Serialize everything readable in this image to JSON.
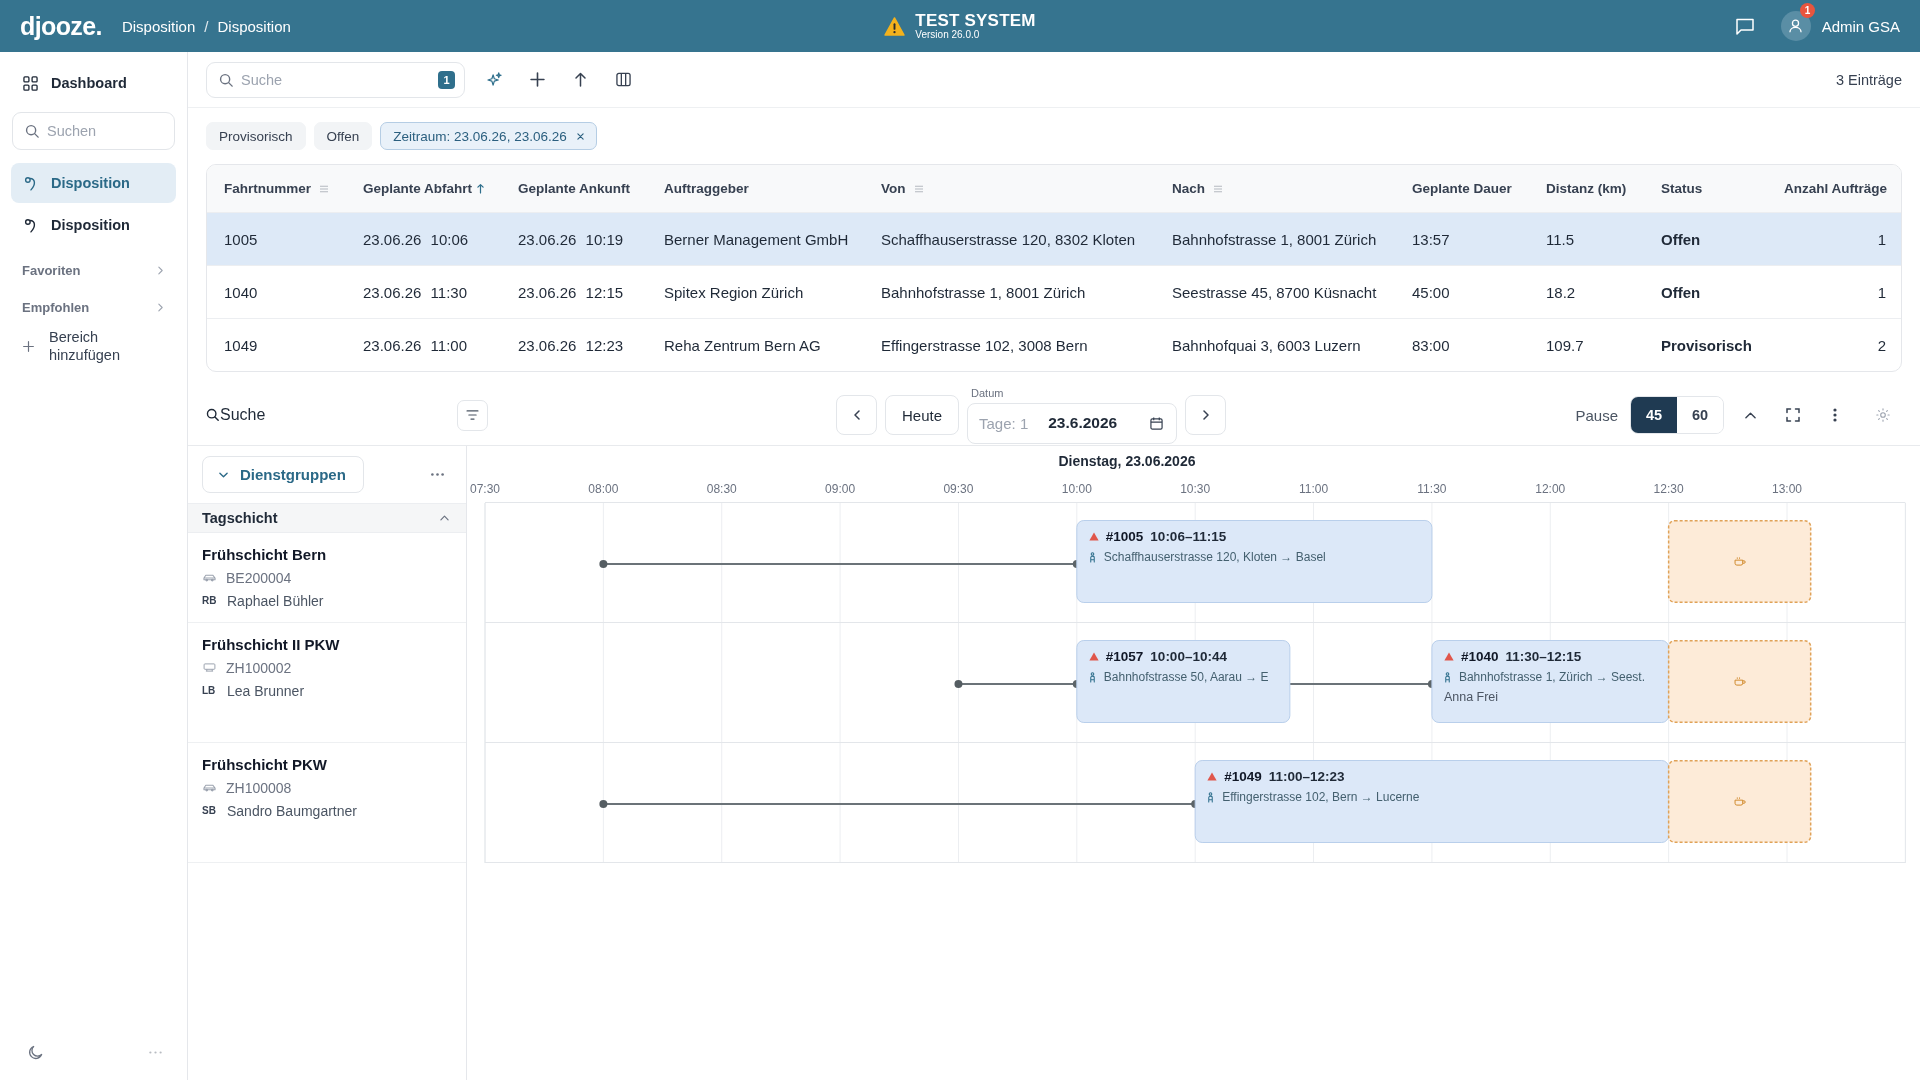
{
  "header": {
    "logo": "djooze.",
    "breadcrumb": [
      "Disposition",
      "Disposition"
    ],
    "separator": "/",
    "system_title": "TEST SYSTEM",
    "system_version": "Version 26.0.0",
    "notification_count": "1",
    "user_name": "Admin GSA"
  },
  "sidebar": {
    "items": [
      {
        "kind": "dashboard",
        "label": "Dashboard",
        "selected": false
      },
      {
        "kind": "search",
        "placeholder": "Suchen"
      },
      {
        "kind": "page",
        "label": "Disposition",
        "selected": true
      },
      {
        "kind": "page",
        "label": "Disposition",
        "selected": false
      },
      {
        "kind": "section",
        "label": "Favoriten"
      },
      {
        "kind": "section",
        "label": "Empfohlen"
      },
      {
        "kind": "add",
        "label": "Bereich hinzufügen"
      }
    ]
  },
  "toolbar": {
    "search": {
      "placeholder": "Suche",
      "badge": "1"
    },
    "count": "3 Einträge"
  },
  "filters": [
    {
      "label": "Provisorisch",
      "selected": false
    },
    {
      "label": "Offen",
      "selected": false
    },
    {
      "label": "Zeitraum: 23.06.26, 23.06.26",
      "selected": true,
      "removable": true
    }
  ],
  "table": {
    "columns": [
      {
        "label": "Fahrtnummer",
        "kind": "text",
        "filterable": true
      },
      {
        "label": "Geplante Abfahrt",
        "kind": "datetime",
        "sorted_ascending": true
      },
      {
        "label": "Geplante Ankunft",
        "kind": "datetime"
      },
      {
        "label": "Auftraggeber",
        "kind": "text"
      },
      {
        "label": "Von",
        "kind": "text",
        "filterable": true
      },
      {
        "label": "Nach",
        "kind": "text",
        "filterable": true
      },
      {
        "label": "Geplante Dauer",
        "kind": "text"
      },
      {
        "label": "Distanz (km)",
        "kind": "text"
      },
      {
        "label": "Status",
        "kind": "status"
      },
      {
        "label": "Anzahl Aufträge",
        "kind": "count"
      }
    ],
    "rows": [
      {
        "selected": true,
        "cells": [
          "1005",
          "23.06.26 10:06",
          "23.06.26 10:19",
          "Berner Management GmbH",
          "Schaffhauserstrasse 120, 8302 Kloten",
          "Bahnhofstrasse 1, 8001 Zürich",
          "13:57",
          "11.5",
          "Offen",
          "1"
        ]
      },
      {
        "selected": false,
        "cells": [
          "1040",
          "23.06.26 11:30",
          "23.06.26 12:15",
          "Spitex Region Zürich",
          "Bahnhofstrasse 1, 8001 Zürich",
          "Seestrasse 45, 8700 Küsnacht",
          "45:00",
          "18.2",
          "Offen",
          "1"
        ]
      },
      {
        "selected": false,
        "cells": [
          "1049",
          "23.06.26 11:00",
          "23.06.26 12:23",
          "Reha Zentrum Bern AG",
          "Effingerstrasse 102, 3008 Bern",
          "Bahnhofquai 3, 6003 Luzern",
          "83:00",
          "109.7",
          "Provisorisch",
          "2"
        ]
      }
    ]
  },
  "planner": {
    "search": {
      "placeholder": "Suche"
    },
    "today_button": "Heute",
    "date": {
      "label": "Datum",
      "days": "Tage: 1",
      "value": "23.6.2026"
    },
    "pause": {
      "label": "Pause",
      "options": [
        {
          "label": "45",
          "selected": true
        },
        {
          "label": "60",
          "selected": false
        }
      ]
    },
    "groups_button": "Dienstgruppen",
    "groups": [
      {
        "name": "Tagschicht",
        "expanded": true,
        "shifts": [
          {
            "name": "Frühschicht Bern",
            "vehicle": {
              "kind": "car",
              "plate": "BE200004"
            },
            "driver": {
              "initials": "RB",
              "name": "Raphael Bühler"
            },
            "trips": [
              {
                "number": "#1005",
                "time": "10:06–11:15",
                "route": "Schaffhauserstrasse 120, Kloten → Basel",
                "warning": true
              }
            ]
          },
          {
            "name": "Frühschicht II PKW",
            "vehicle": {
              "kind": "van",
              "plate": "ZH100002"
            },
            "driver": {
              "initials": "LB",
              "name": "Lea Brunner"
            },
            "trips": [
              {
                "number": "#1057",
                "time": "10:00–10:44",
                "route": "Bahnhofstrasse 50, Aarau → E",
                "warning": true
              },
              {
                "number": "#1040",
                "time": "11:30–12:15",
                "route": "Bahnhofstrasse 1, Zürich → Seest.",
                "person_name": "Anna Frei",
                "warning": true
              }
            ]
          },
          {
            "name": "Frühschicht PKW",
            "vehicle": {
              "kind": "car",
              "plate": "ZH100008"
            },
            "driver": {
              "initials": "SB",
              "name": "Sandro Baumgartner"
            },
            "trips": [
              {
                "number": "#1049",
                "time": "11:00–12:23",
                "route": "Effingerstrasse 102, Bern → Lucerne",
                "warning": true
              }
            ]
          }
        ]
      }
    ],
    "chart_data": [
      {
        "type": "bar",
        "orientation": "horizontal",
        "title": "Dienstag, 23.06.2026",
        "categories": [
          null,
          null,
          null
        ],
        "xlim": [
          7.5,
          13.5
        ],
        "xticks": [
          {
            "value": 7.5,
            "label": "07:30"
          },
          {
            "value": 8,
            "label": "08:00"
          },
          {
            "value": 8.5,
            "label": "08:30"
          },
          {
            "value": 9,
            "label": "09:00"
          },
          {
            "value": 9.5,
            "label": "09:30"
          },
          {
            "value": 10,
            "label": "10:00"
          },
          {
            "value": 10.5,
            "label": "10:30"
          },
          {
            "value": 11,
            "label": "11:00"
          },
          {
            "value": 11.5,
            "label": "11:30"
          },
          {
            "value": 12,
            "label": "12:00"
          },
          {
            "value": 12.5,
            "label": "12:30"
          },
          {
            "value": 13,
            "label": "13:00"
          }
        ],
        "grid": true,
        "series": [
          {
            "type": "bar",
            "color": "#dce8f8",
            "base": [
              10,
              10,
              10.5
            ],
            "values": [
              1.5,
              0.9,
              2
            ]
          },
          {
            "type": "bar",
            "color": "#dce8f8",
            "base": [
              null,
              11.5,
              null
            ],
            "values": [
              null,
              1,
              null
            ]
          },
          {
            "type": "bar",
            "color": "#fdebd8",
            "line_style": "dashed",
            "base": [
              12.5,
              12.5,
              12.5
            ],
            "values": [
              0.6,
              0.6,
              0.6
            ]
          },
          {
            "type": "scatter",
            "color": "#555d62",
            "values": [
              8,
              9.5,
              8
            ]
          }
        ]
      }
    ]
  }
}
